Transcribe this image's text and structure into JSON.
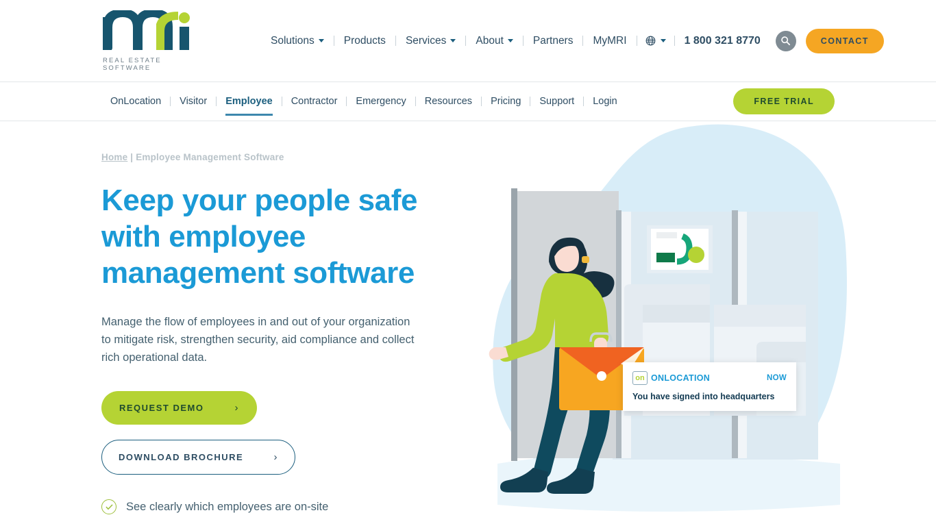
{
  "header": {
    "logo": {
      "name": "mri",
      "tagline": "REAL ESTATE SOFTWARE"
    },
    "nav": [
      {
        "label": "Solutions",
        "has_dropdown": true
      },
      {
        "label": "Products",
        "has_dropdown": false
      },
      {
        "label": "Services",
        "has_dropdown": true
      },
      {
        "label": "About",
        "has_dropdown": true
      },
      {
        "label": "Partners",
        "has_dropdown": false
      },
      {
        "label": "MyMRI",
        "has_dropdown": false
      }
    ],
    "language_icon": "globe-icon",
    "phone": "1 800 321 8770",
    "search_icon": "search-icon",
    "contact_label": "CONTACT"
  },
  "subnav": {
    "items": [
      {
        "label": "OnLocation",
        "active": false
      },
      {
        "label": "Visitor",
        "active": false
      },
      {
        "label": "Employee",
        "active": true
      },
      {
        "label": "Contractor",
        "active": false
      },
      {
        "label": "Emergency",
        "active": false
      },
      {
        "label": "Resources",
        "active": false
      },
      {
        "label": "Pricing",
        "active": false
      },
      {
        "label": "Support",
        "active": false
      },
      {
        "label": "Login",
        "active": false
      }
    ],
    "trial_label": "FREE TRIAL"
  },
  "hero": {
    "breadcrumb_home": "Home",
    "breadcrumb_sep": " | ",
    "breadcrumb_current": "Employee Management Software",
    "title": "Keep your people safe with employee management software",
    "description": "Manage the flow of employees in and out of your organization to mitigate risk, strengthen security, aid compliance and collect rich operational data.",
    "primary_cta": "REQUEST DEMO",
    "secondary_cta": "DOWNLOAD BROCHURE",
    "cta_arrow": "›",
    "benefit": "See clearly which employees are on-site"
  },
  "notification": {
    "badge": "on",
    "brand": "ONLOCATION",
    "time": "NOW",
    "message": "You have signed into headquarters"
  },
  "colors": {
    "brand_teal": "#1b5e7e",
    "brand_green": "#b5d334",
    "accent_blue": "#1b9ad6",
    "orange": "#f5a623",
    "text": "#2e4d63"
  }
}
